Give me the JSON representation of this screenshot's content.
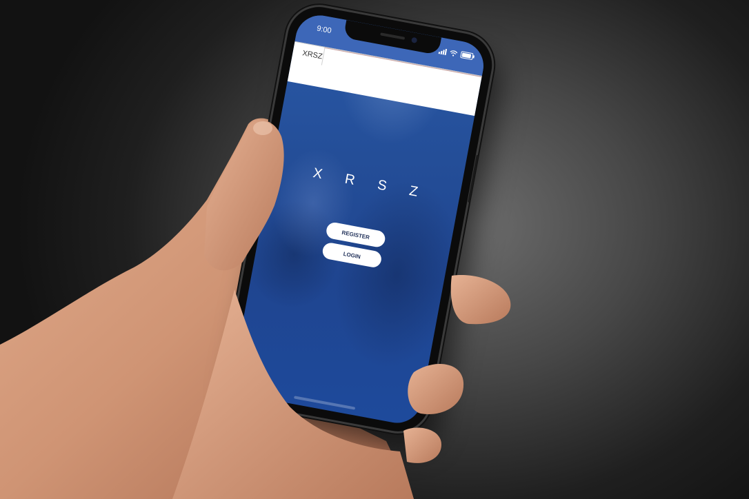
{
  "status_bar": {
    "time": "9:00"
  },
  "header": {
    "title": "XRSZ"
  },
  "main": {
    "logo": "X R S Z",
    "register_label": "REGISTER",
    "login_label": "LOGIN"
  },
  "colors": {
    "screen_blue": "#2450a0",
    "status_bar_blue": "#3d67b8",
    "button_text": "#24345c",
    "background": "#2a2a2a"
  },
  "icons": [
    "signal-icon",
    "wifi-icon",
    "battery-icon"
  ]
}
